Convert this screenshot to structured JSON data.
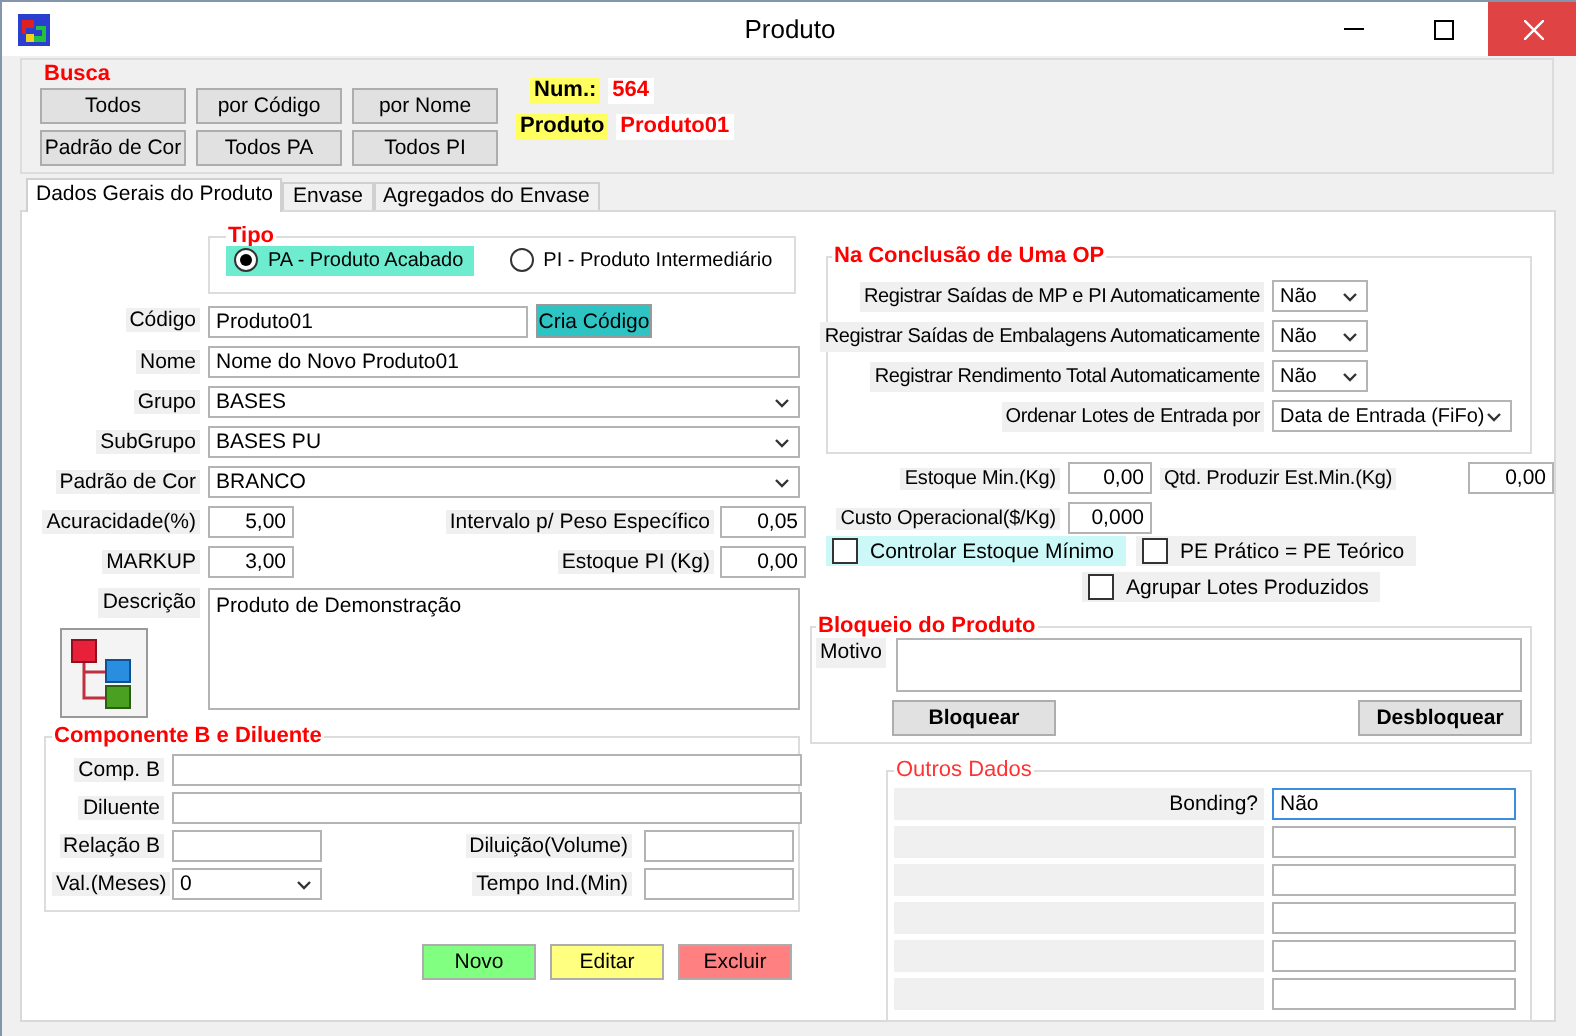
{
  "window": {
    "title": "Produto"
  },
  "busca": {
    "title": "Busca",
    "buttons": [
      "Todos",
      "por Código",
      "por Nome",
      "Padrão de Cor",
      "Todos PA",
      "Todos PI"
    ],
    "num_label": "Num.:",
    "num_value": "564",
    "produto_label": "Produto",
    "produto_value": "Produto01"
  },
  "tabs": [
    {
      "label": "Dados Gerais do Produto",
      "selected": true
    },
    {
      "label": "Envase",
      "selected": false
    },
    {
      "label": "Agregados do Envase",
      "selected": false
    }
  ],
  "tipo": {
    "title": "Tipo",
    "options": [
      {
        "label": "PA - Produto Acabado",
        "selected": true
      },
      {
        "label": "PI - Produto Intermediário",
        "selected": false
      }
    ]
  },
  "codigo": {
    "label": "Código",
    "value": "Produto01",
    "button": "Cria Código"
  },
  "details": [
    {
      "label": "Nome",
      "value": "Nome do Novo Produto01",
      "kind": "text"
    },
    {
      "label": "Grupo",
      "value": "BASES",
      "kind": "select"
    },
    {
      "label": "SubGrupo",
      "value": "BASES PU",
      "kind": "select"
    },
    {
      "label": "Padrão de Cor",
      "value": "BRANCO",
      "kind": "select"
    }
  ],
  "measures": [
    {
      "label": "Acuracidade(%)",
      "value": "5,00",
      "label_2": "Intervalo p/ Peso Específico",
      "value_2": "0,05"
    },
    {
      "label": "MARKUP",
      "value": "3,00",
      "label_2": "Estoque PI (Kg)",
      "value_2": "0,00"
    }
  ],
  "descricao": {
    "label": "Descrição",
    "value": "Produto de Demonstração"
  },
  "componente": {
    "title": "Componente B e Diluente",
    "fields": [
      {
        "label": "Comp. B"
      },
      {
        "label": "Diluente"
      }
    ],
    "pairs": [
      {
        "label": "Relação B",
        "kind": "text",
        "label_2": "Diluição(Volume)"
      },
      {
        "label": "Val.(Meses)",
        "kind": "select",
        "value": "0",
        "label_2": "Tempo Ind.(Min)"
      }
    ]
  },
  "actions": [
    {
      "label": "Novo",
      "color": "#80ff80"
    },
    {
      "label": "Editar",
      "color": "#ffff80"
    },
    {
      "label": "Excluir",
      "color": "#ff8080"
    }
  ],
  "conclusao": {
    "title": "Na Conclusão de Uma OP",
    "rows": [
      {
        "label": "Registrar Saídas de MP e PI Automaticamente",
        "value": "Não",
        "kind": "short"
      },
      {
        "label": "Registrar Saídas de Embalagens Automaticamente",
        "value": "Não",
        "kind": "short"
      },
      {
        "label": "Registrar Rendimento Total Automaticamente",
        "value": "Não",
        "kind": "short"
      },
      {
        "label": "Ordenar Lotes de Entrada por",
        "value": "Data de Entrada (FiFo)",
        "kind": "wide"
      }
    ]
  },
  "estoque": [
    {
      "label": "Estoque Min.(Kg)",
      "value": "0,00",
      "label_2": "Qtd. Produzir Est.Min.(Kg)",
      "value_2": "0,00"
    },
    {
      "label": "Custo Operacional($/Kg)",
      "value": "0,000"
    }
  ],
  "checks": [
    {
      "label": "Controlar Estoque Mínimo",
      "checked": false,
      "highlighted": true
    },
    {
      "label": "PE Prático = PE Teórico",
      "checked": false,
      "highlighted": false
    },
    {
      "label": "Agrupar Lotes Produzidos",
      "checked": false,
      "highlighted": false
    }
  ],
  "bloqueio": {
    "title": "Bloqueio do Produto",
    "label": "Motivo",
    "buttons": [
      "Bloquear",
      "Desbloquear"
    ]
  },
  "outros": {
    "title": "Outros Dados",
    "rows": [
      {
        "label": "Bonding?",
        "value": "Não",
        "focused": true
      },
      {
        "focused": false
      },
      {
        "focused": false
      },
      {
        "focused": false
      },
      {
        "focused": false
      },
      {
        "focused": false
      }
    ]
  }
}
